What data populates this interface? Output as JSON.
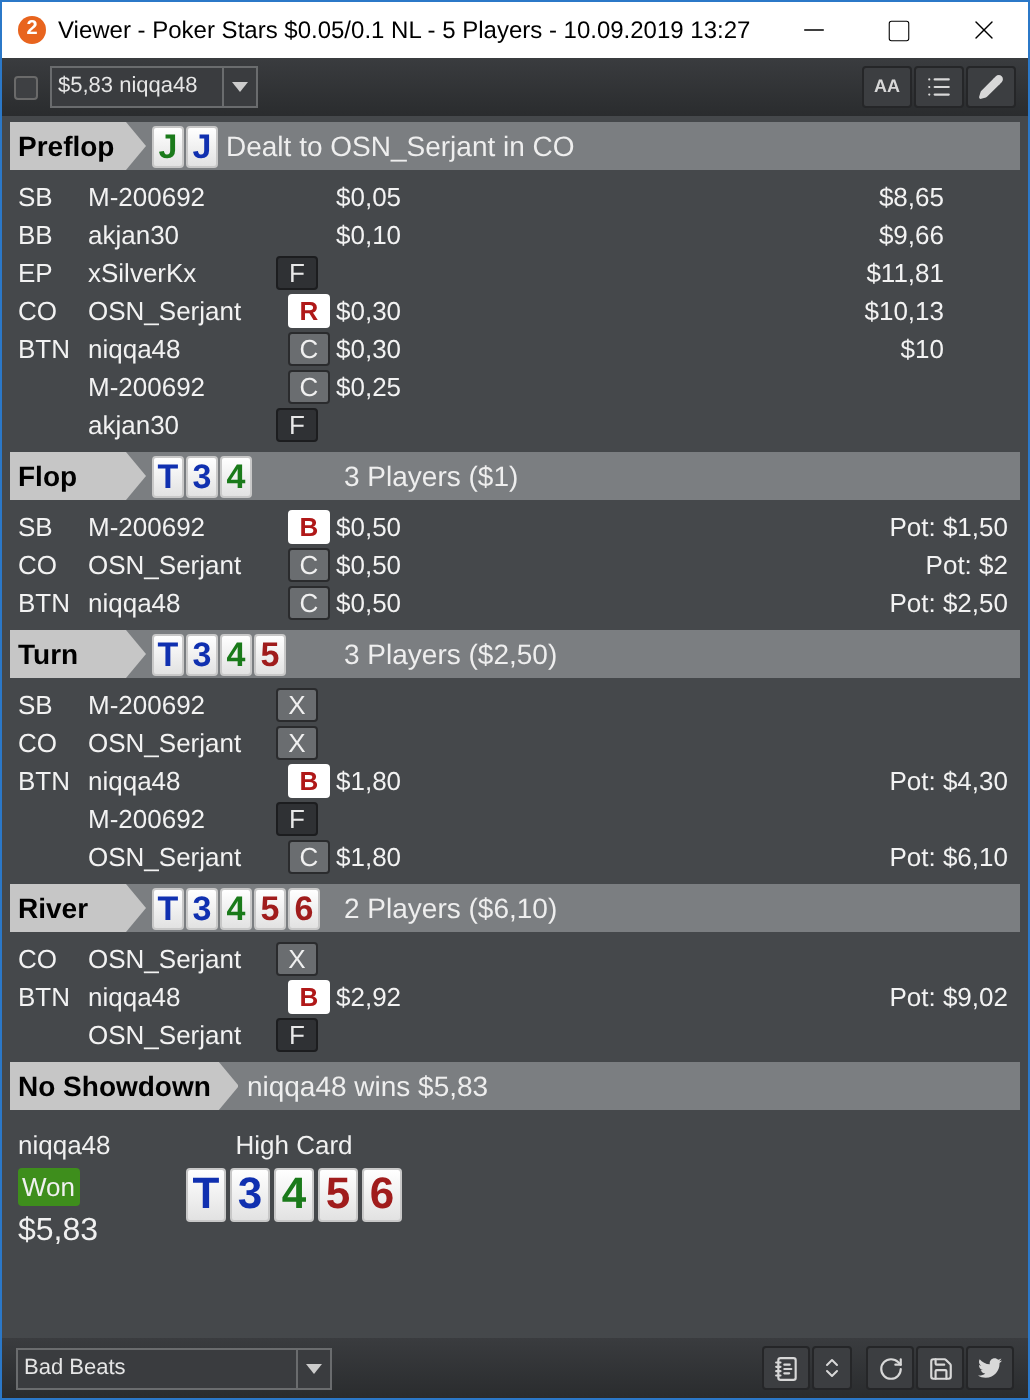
{
  "window": {
    "app_badge": "2",
    "title": "Viewer - Poker Stars $0.05/0.1 NL - 5 Players - 10.09.2019 13:27"
  },
  "toolbar": {
    "checked": false,
    "hand": "$5,83 niqqa48",
    "font_button": "AA"
  },
  "sections": [
    {
      "label": "Preflop",
      "kind": "deal",
      "cards": [
        {
          "rank": "J",
          "color": "#1a7a1a"
        },
        {
          "rank": "J",
          "color": "#1030b0"
        }
      ],
      "summary": "Dealt to OSN_Serjant in CO",
      "rows": [
        {
          "position": "SB",
          "player": "M-200692",
          "amount": "$0,05",
          "stack": "$8,65"
        },
        {
          "position": "BB",
          "player": "akjan30",
          "amount": "$0,10",
          "stack": "$9,66"
        },
        {
          "position": "EP",
          "player": "xSilverKx",
          "action": {
            "kind": "fold",
            "letter": "F"
          },
          "stack": "$11,81"
        },
        {
          "position": "CO",
          "player": "OSN_Serjant",
          "action": {
            "kind": "raise",
            "letter": "R"
          },
          "amount": "$0,30",
          "stack": "$10,13"
        },
        {
          "position": "BTN",
          "player": "niqqa48",
          "action": {
            "kind": "call",
            "letter": "C"
          },
          "amount": "$0,30",
          "stack": "$10"
        },
        {
          "player": "M-200692",
          "action": {
            "kind": "call",
            "letter": "C"
          },
          "amount": "$0,25"
        },
        {
          "player": "akjan30",
          "action": {
            "kind": "fold",
            "letter": "F"
          }
        }
      ]
    },
    {
      "label": "Flop",
      "kind": "street",
      "cards": [
        {
          "rank": "T",
          "color": "#1030b0"
        },
        {
          "rank": "3",
          "color": "#1030b0"
        },
        {
          "rank": "4",
          "color": "#1a7a1a"
        }
      ],
      "summary": "3 Players ($1)",
      "rows": [
        {
          "position": "SB",
          "player": "M-200692",
          "action": {
            "kind": "bet",
            "letter": "B"
          },
          "amount": "$0,50",
          "pot": "Pot: $1,50"
        },
        {
          "position": "CO",
          "player": "OSN_Serjant",
          "action": {
            "kind": "call",
            "letter": "C"
          },
          "amount": "$0,50",
          "pot": "Pot: $2"
        },
        {
          "position": "BTN",
          "player": "niqqa48",
          "action": {
            "kind": "call",
            "letter": "C"
          },
          "amount": "$0,50",
          "pot": "Pot: $2,50"
        }
      ]
    },
    {
      "label": "Turn",
      "kind": "street",
      "cards": [
        {
          "rank": "T",
          "color": "#1030b0"
        },
        {
          "rank": "3",
          "color": "#1030b0"
        },
        {
          "rank": "4",
          "color": "#1a7a1a"
        },
        {
          "rank": "5",
          "color": "#a01c1c"
        }
      ],
      "summary": "3 Players ($2,50)",
      "rows": [
        {
          "position": "SB",
          "player": "M-200692",
          "action": {
            "kind": "check",
            "letter": "X"
          }
        },
        {
          "position": "CO",
          "player": "OSN_Serjant",
          "action": {
            "kind": "check",
            "letter": "X"
          }
        },
        {
          "position": "BTN",
          "player": "niqqa48",
          "action": {
            "kind": "bet",
            "letter": "B"
          },
          "amount": "$1,80",
          "pot": "Pot: $4,30"
        },
        {
          "player": "M-200692",
          "action": {
            "kind": "fold",
            "letter": "F"
          }
        },
        {
          "player": "OSN_Serjant",
          "action": {
            "kind": "call",
            "letter": "C"
          },
          "amount": "$1,80",
          "pot": "Pot: $6,10"
        }
      ]
    },
    {
      "label": "River",
      "kind": "street",
      "cards": [
        {
          "rank": "T",
          "color": "#1030b0"
        },
        {
          "rank": "3",
          "color": "#1030b0"
        },
        {
          "rank": "4",
          "color": "#1a7a1a"
        },
        {
          "rank": "5",
          "color": "#a01c1c"
        },
        {
          "rank": "6",
          "color": "#a01c1c"
        }
      ],
      "summary": "2 Players ($6,10)",
      "rows": [
        {
          "position": "CO",
          "player": "OSN_Serjant",
          "action": {
            "kind": "check",
            "letter": "X"
          }
        },
        {
          "position": "BTN",
          "player": "niqqa48",
          "action": {
            "kind": "bet",
            "letter": "B"
          },
          "amount": "$2,92",
          "pot": "Pot: $9,02"
        },
        {
          "player": "OSN_Serjant",
          "action": {
            "kind": "fold",
            "letter": "F"
          }
        }
      ]
    },
    {
      "label": "No Showdown",
      "kind": "result",
      "summary": "niqqa48 wins $5,83"
    }
  ],
  "result": {
    "player": "niqqa48",
    "badge": "Won",
    "amount": "$5,83",
    "hand_name": "High Card",
    "cards": [
      {
        "rank": "T",
        "color": "#1030b0"
      },
      {
        "rank": "3",
        "color": "#1030b0"
      },
      {
        "rank": "4",
        "color": "#1a7a1a"
      },
      {
        "rank": "5",
        "color": "#a01c1c"
      },
      {
        "rank": "6",
        "color": "#a01c1c"
      }
    ]
  },
  "footer": {
    "filter": "Bad Beats"
  }
}
